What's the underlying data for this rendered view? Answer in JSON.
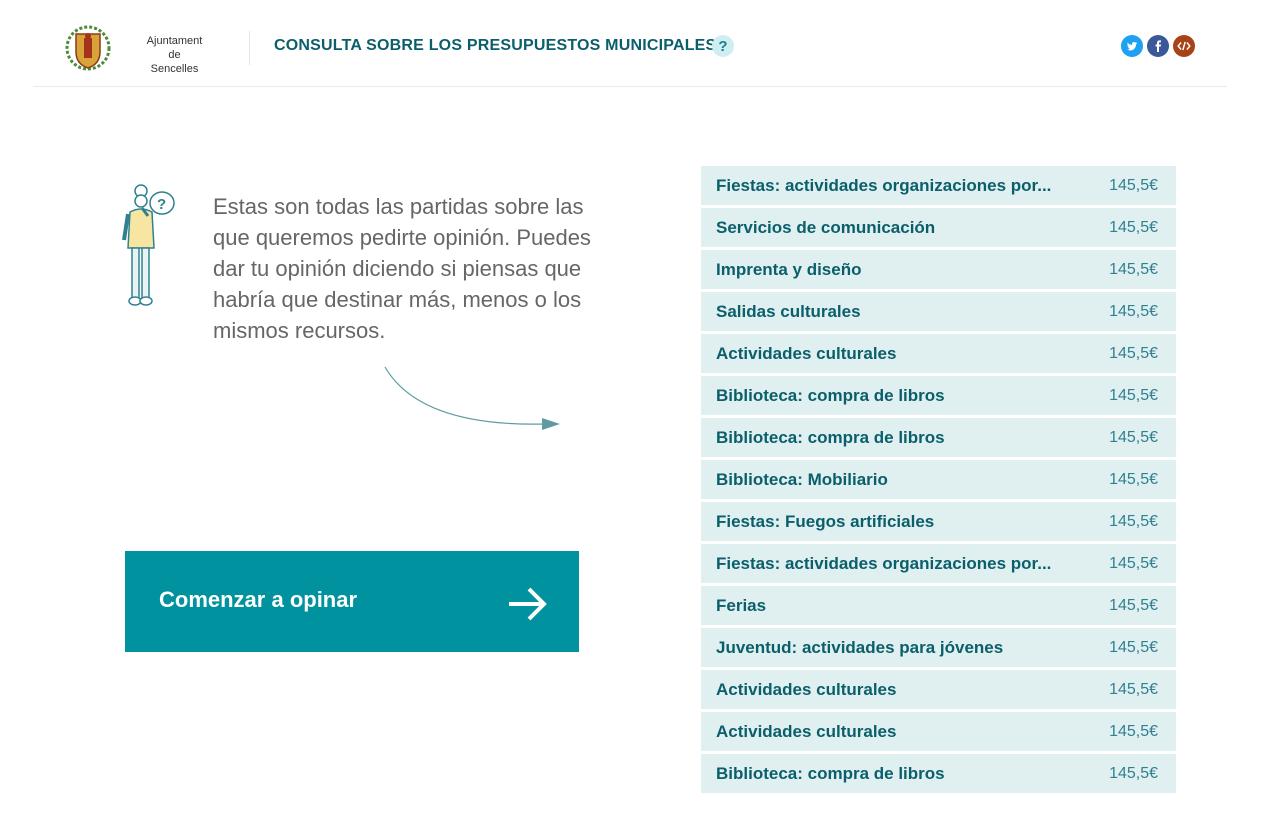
{
  "header": {
    "logo_line1": "Ajuntament de",
    "logo_line2": "Sencelles",
    "title": "CONSULTA SOBRE LOS PRESUPUESTOS MUNICIPALES",
    "help_label": "?"
  },
  "social": {
    "twitter_color": "#1da1f2",
    "facebook_color": "#3b5998",
    "embed_color": "#a84217"
  },
  "intro": {
    "text": "Estas son todas las partidas sobre las que queremos pedirte opinión. Puedes dar tu opinión diciendo si piensas que habría que destinar más, menos o los mismos recursos."
  },
  "cta": {
    "label": "Comenzar a opinar"
  },
  "items": [
    {
      "label": "Fiestas: actividades organizaciones por...",
      "value": "145,5€"
    },
    {
      "label": "Servicios de comunicación",
      "value": "145,5€"
    },
    {
      "label": "Imprenta y diseño",
      "value": "145,5€"
    },
    {
      "label": "Salidas culturales",
      "value": "145,5€"
    },
    {
      "label": "Actividades culturales",
      "value": "145,5€"
    },
    {
      "label": "Biblioteca: compra de libros",
      "value": "145,5€"
    },
    {
      "label": "Biblioteca: compra de libros",
      "value": "145,5€"
    },
    {
      "label": "Biblioteca: Mobiliario",
      "value": "145,5€"
    },
    {
      "label": "Fiestas: Fuegos artificiales",
      "value": "145,5€"
    },
    {
      "label": "Fiestas: actividades organizaciones por...",
      "value": "145,5€"
    },
    {
      "label": "Ferias",
      "value": "145,5€"
    },
    {
      "label": "Juventud: actividades para jóvenes",
      "value": "145,5€"
    },
    {
      "label": "Actividades culturales",
      "value": "145,5€"
    },
    {
      "label": "Actividades culturales",
      "value": "145,5€"
    },
    {
      "label": "Biblioteca: compra de libros",
      "value": "145,5€"
    }
  ],
  "colors": {
    "accent": "#00929e",
    "title": "#0b5f6b",
    "row_bg": "#e0eff0"
  }
}
